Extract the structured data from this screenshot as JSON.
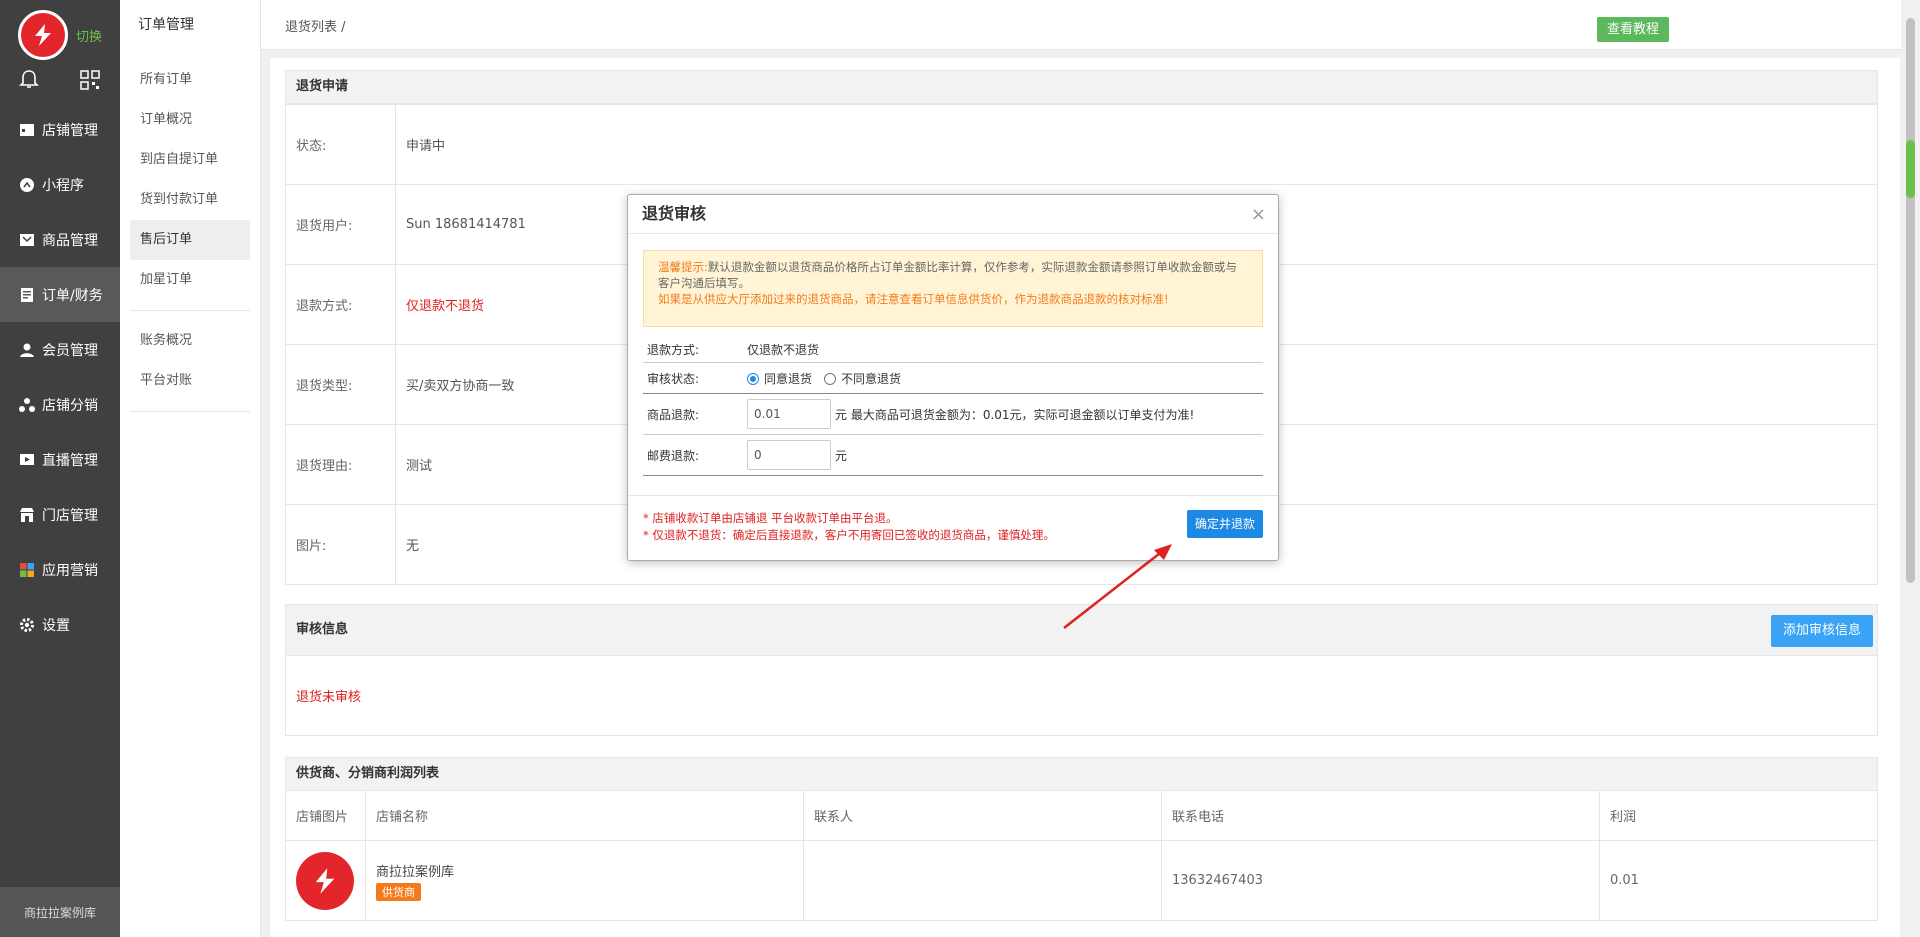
{
  "sidebar": {
    "switch_label": "切换",
    "footer": "商拉拉案例库",
    "items": [
      {
        "label": "店铺管理"
      },
      {
        "label": "小程序"
      },
      {
        "label": "商品管理"
      },
      {
        "label": "订单/财务"
      },
      {
        "label": "会员管理"
      },
      {
        "label": "店铺分销"
      },
      {
        "label": "直播管理"
      },
      {
        "label": "门店管理"
      },
      {
        "label": "应用营销"
      },
      {
        "label": "设置"
      }
    ]
  },
  "subnav": {
    "title": "订单管理",
    "group1": [
      "所有订单",
      "订单概况",
      "到店自提订单",
      "货到付款订单",
      "售后订单",
      "加星订单"
    ],
    "group2": [
      "账务概况",
      "平台对账"
    ]
  },
  "header": {
    "breadcrumb": "退货列表 /",
    "tutorial_button": "查看教程"
  },
  "refund_apply": {
    "title": "退货申请",
    "rows": [
      {
        "label": "状态:",
        "value": "申请中"
      },
      {
        "label": "退货用户:",
        "value": "Sun 18681414781"
      },
      {
        "label": "退款方式:",
        "value": "仅退款不退货"
      },
      {
        "label": "退货类型:",
        "value": "买/卖双方协商一致"
      },
      {
        "label": "退货理由:",
        "value": "测试"
      },
      {
        "label": "图片:",
        "value": "无"
      }
    ]
  },
  "audit_info": {
    "title": "审核信息",
    "add_button": "添加审核信息",
    "status": "退货未审核"
  },
  "profit_list": {
    "title": "供货商、分销商利润列表",
    "columns": [
      "店铺图片",
      "店铺名称",
      "联系人",
      "联系电话",
      "利润"
    ],
    "rows": [
      {
        "store_name": "商拉拉案例库",
        "badge": "供货商",
        "contact": "",
        "phone": "13632467403",
        "profit": "0.01"
      }
    ]
  },
  "modal": {
    "title": "退货审核",
    "close": "×",
    "tip_label": "温馨提示:",
    "tip_text": "默认退款金额以退货商品价格所占订单金额比率计算，仅作参考，实际退款金额请参照订单收款金额或与客户沟通后填写。",
    "tip_warn": "如果是从供应大厅添加过来的退货商品，请注意查看订单信息供货价，作为退款商品退款的核对标准!",
    "refund_method_label": "退款方式:",
    "refund_method_value": "仅退款不退货",
    "audit_status_label": "审核状态:",
    "agree_label": "同意退货",
    "disagree_label": "不同意退货",
    "goods_refund_label": "商品退款:",
    "goods_refund_value": "0.01",
    "goods_refund_note": "元 最大商品可退货金额为：0.01元，实际可退金额以订单支付为准!",
    "shipping_refund_label": "邮费退款:",
    "shipping_refund_value": "0",
    "shipping_unit": "元",
    "note1": "* 店铺收款订单由店铺退 平台收款订单由平台退。",
    "note2": "* 仅退款不退货：确定后直接退款，客户不用寄回已签收的退货商品，谨慎处理。",
    "confirm_button": "确定并退款"
  }
}
